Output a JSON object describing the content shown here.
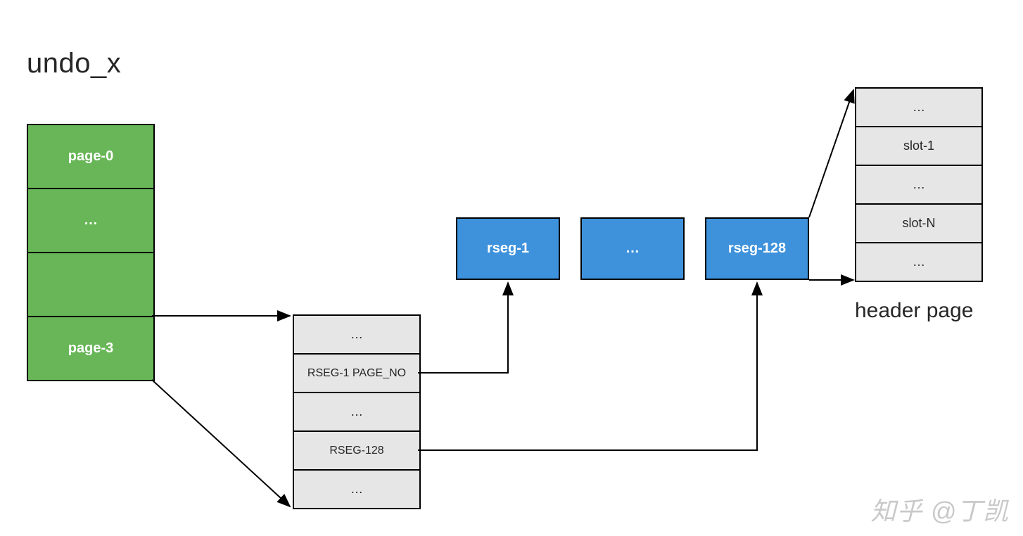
{
  "title": "undo_x",
  "undo_pages": {
    "cells": [
      "page-0",
      "…",
      "",
      "page-3"
    ]
  },
  "rseg_directory": {
    "cells": [
      "…",
      "RSEG-1 PAGE_NO",
      "…",
      "RSEG-128",
      "…"
    ]
  },
  "rseg_boxes": {
    "r1": "rseg-1",
    "r_ellipsis": "…",
    "r128": "rseg-128"
  },
  "header_page": {
    "caption": "header page",
    "cells": [
      "…",
      "slot-1",
      "…",
      "slot-N",
      "…"
    ]
  },
  "watermark": "知乎 @丁凯",
  "colors": {
    "green": "#68b657",
    "gray": "#e6e6e6",
    "blue": "#3e92dc"
  }
}
